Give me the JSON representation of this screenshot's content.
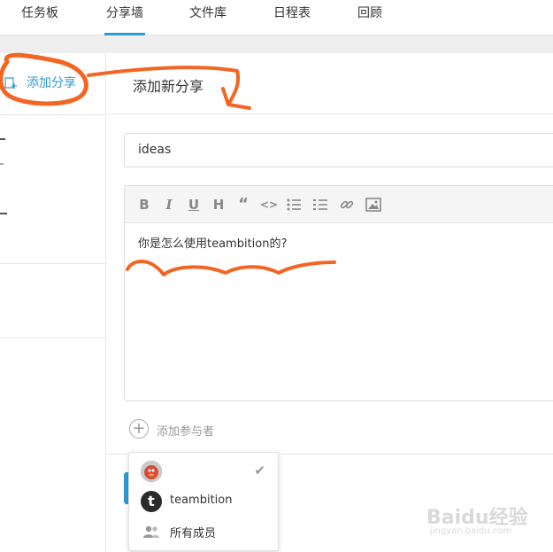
{
  "topnav": {
    "tabs": [
      {
        "label": "任务板",
        "active": false
      },
      {
        "label": "分享墙",
        "active": true
      },
      {
        "label": "文件库",
        "active": false
      },
      {
        "label": "日程表",
        "active": false
      },
      {
        "label": "回顾",
        "active": false
      }
    ]
  },
  "sidebar": {
    "add_share_label": "添加分享"
  },
  "main": {
    "title": "添加新分享",
    "title_input_value": "ideas",
    "editor": {
      "toolbar_icons": [
        "bold-icon",
        "italic-icon",
        "underline-icon",
        "heading-icon",
        "quote-icon",
        "code-icon",
        "bulleted-list-icon",
        "numbered-list-icon",
        "link-icon",
        "image-icon"
      ],
      "content": "你是怎么使用teambition的?"
    },
    "add_participant_label": "添加参与者"
  },
  "dropdown": {
    "items": [
      {
        "label": "",
        "avatar": "user-avatar",
        "checked": true
      },
      {
        "label": "teambition",
        "avatar": "t",
        "checked": false
      },
      {
        "label": "所有成员",
        "avatar": "group-icon",
        "checked": false
      }
    ]
  },
  "watermark": {
    "text": "Baidu经验",
    "sub": "jingyan.baidu.com"
  },
  "colors": {
    "accent": "#2e9bd6",
    "annotation": "#f26522"
  }
}
